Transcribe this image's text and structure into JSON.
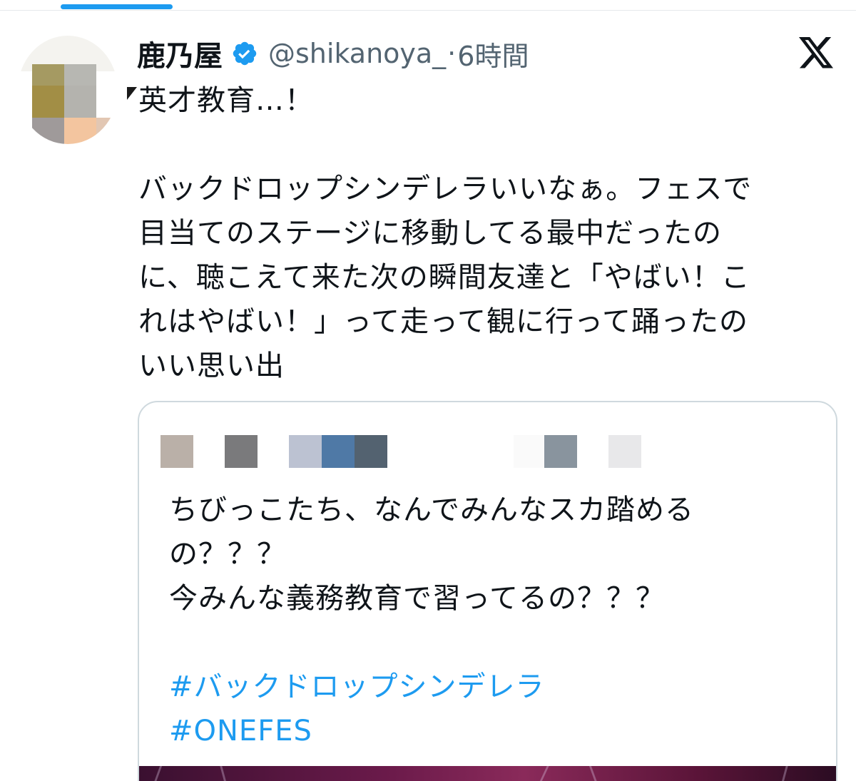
{
  "tweet": {
    "author_name": "鹿乃屋",
    "handle": "@shikanoya_",
    "separator": "·",
    "time": "6時間",
    "text_lines": [
      "英才教育…！",
      "",
      "バックドロップシンデレラいいなぁ。フェスで",
      "目当てのステージに移動してる最中だったの",
      "に、聴こえて来た次の瞬間友達と「やばい！こ",
      "れはやばい！」って走って観に行って踊ったの",
      "いい思い出"
    ]
  },
  "quote": {
    "text_lines": [
      "ちびっこたち、なんでみんなスカ踏める",
      "の？？？",
      "今みんな義務教育で習ってるの？？？",
      ""
    ],
    "hashtags": [
      "#バックドロップシンデレラ",
      "#ONEFES"
    ]
  },
  "icons": {
    "verified": "verified-badge-icon",
    "platform_logo": "x-logo-icon"
  },
  "colors": {
    "accent": "#1d9bf0",
    "secondary_text": "#536471",
    "primary_text": "#0f1419",
    "border": "#cfd9de"
  }
}
